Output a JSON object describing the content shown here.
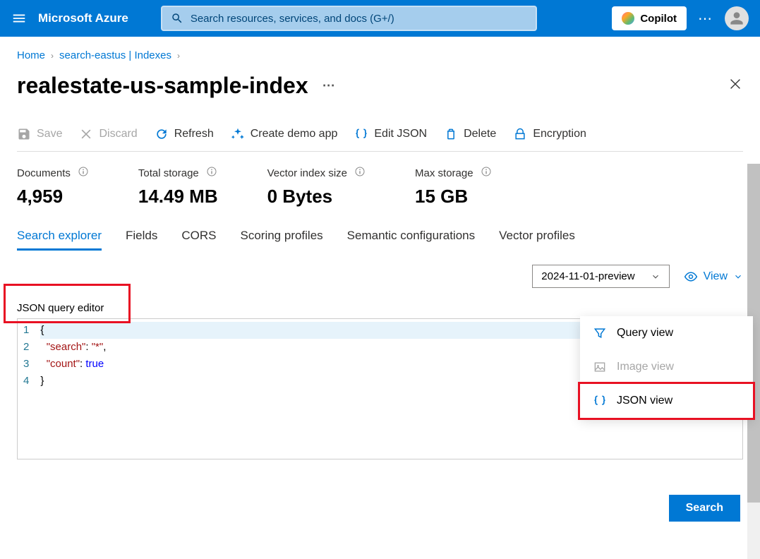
{
  "header": {
    "brand": "Microsoft Azure",
    "search_placeholder": "Search resources, services, and docs (G+/)",
    "copilot_label": "Copilot"
  },
  "breadcrumb": {
    "items": [
      "Home",
      "search-eastus | Indexes"
    ]
  },
  "page": {
    "title": "realestate-us-sample-index"
  },
  "toolbar": {
    "save": "Save",
    "discard": "Discard",
    "refresh": "Refresh",
    "create_demo": "Create demo app",
    "edit_json": "Edit JSON",
    "delete": "Delete",
    "encryption": "Encryption"
  },
  "stats": {
    "documents": {
      "label": "Documents",
      "value": "4,959"
    },
    "total_storage": {
      "label": "Total storage",
      "value": "14.49 MB"
    },
    "vector_index": {
      "label": "Vector index size",
      "value": "0 Bytes"
    },
    "max_storage": {
      "label": "Max storage",
      "value": "15 GB"
    }
  },
  "tabs": {
    "search_explorer": "Search explorer",
    "fields": "Fields",
    "cors": "CORS",
    "scoring": "Scoring profiles",
    "semantic": "Semantic configurations",
    "vector": "Vector profiles"
  },
  "controls": {
    "api_version": "2024-11-01-preview",
    "view_label": "View"
  },
  "view_menu": {
    "query": "Query view",
    "image": "Image view",
    "json": "JSON view"
  },
  "editor": {
    "label": "JSON query editor",
    "lines": {
      "l1": "{",
      "l2_key": "\"search\"",
      "l2_val": "\"*\"",
      "l3_key": "\"count\"",
      "l3_val": "true",
      "l4": "}"
    }
  },
  "search_button": "Search"
}
